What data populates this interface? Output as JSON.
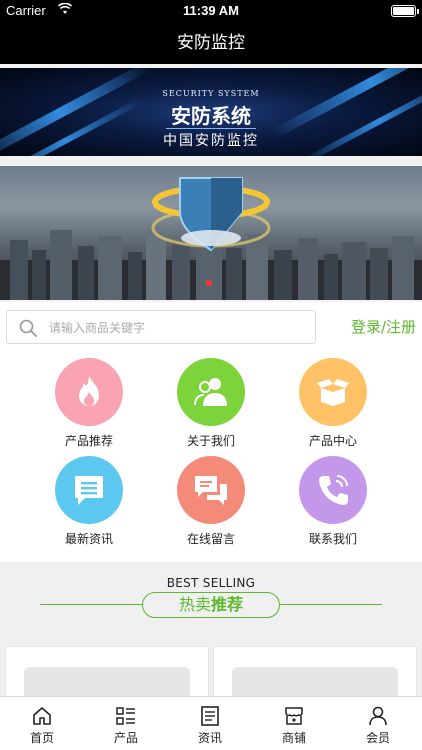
{
  "status_bar": {
    "carrier": "Carrier",
    "time": "11:39 AM"
  },
  "nav": {
    "title": "安防监控"
  },
  "banner1": {
    "en": "SECURITY SYSTEM",
    "cn": "安防系统",
    "sub": "中国安防监控"
  },
  "search": {
    "placeholder": "请输入商品关键字",
    "login_label": "登录/注册"
  },
  "grid": [
    {
      "label": "产品推荐",
      "icon": "flame-icon",
      "color": "#f9a3b3"
    },
    {
      "label": "关于我们",
      "icon": "users-icon",
      "color": "#7dd33a"
    },
    {
      "label": "产品中心",
      "icon": "box-icon",
      "color": "#ffc266"
    },
    {
      "label": "最新资讯",
      "icon": "chat-lines-icon",
      "color": "#5cc8f0"
    },
    {
      "label": "在线留言",
      "icon": "chat-bubbles-icon",
      "color": "#f48a78"
    },
    {
      "label": "联系我们",
      "icon": "phone-icon",
      "color": "#c398ea"
    }
  ],
  "best": {
    "en": "BEST SELLING",
    "title_a": "热卖",
    "title_b": "推荐"
  },
  "tabbar": [
    {
      "label": "首页",
      "icon": "home-icon"
    },
    {
      "label": "产品",
      "icon": "list-icon"
    },
    {
      "label": "资讯",
      "icon": "news-icon"
    },
    {
      "label": "商铺",
      "icon": "store-icon"
    },
    {
      "label": "会员",
      "icon": "user-icon"
    }
  ],
  "colors": {
    "accent": "#5cb82d",
    "bar": "#000000"
  }
}
